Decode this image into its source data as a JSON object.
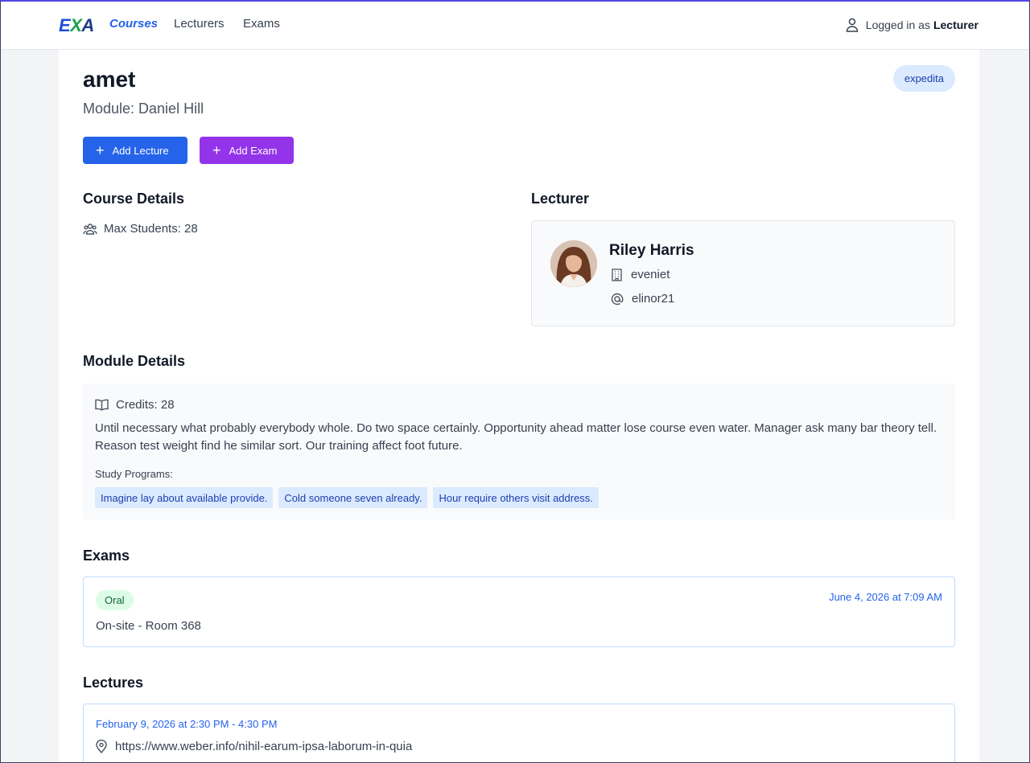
{
  "nav": {
    "logo": [
      "E",
      "X",
      "A"
    ],
    "links": [
      "Courses",
      "Lecturers",
      "Exams"
    ],
    "user_prefix": "Logged in as",
    "user_role": "Lecturer"
  },
  "course": {
    "title": "amet",
    "module_line": "Module: Daniel Hill",
    "tag": "expedita"
  },
  "actions": {
    "add_lecture": "Add Lecture",
    "add_exam": "Add Exam"
  },
  "course_details": {
    "heading": "Course Details",
    "max_students": "Max Students: 28"
  },
  "lecturer": {
    "heading": "Lecturer",
    "name": "Riley Harris",
    "department": "eveniet",
    "username": "elinor21"
  },
  "module_details": {
    "heading": "Module Details",
    "credits": "Credits: 28",
    "description": "Until necessary what probably everybody whole. Do two space certainly. Opportunity ahead matter lose course even water. Manager ask many bar theory tell. Reason test weight find he similar sort. Our training affect foot future.",
    "study_programs_label": "Study Programs:",
    "study_programs": [
      "Imagine lay about available provide.",
      "Cold someone seven already.",
      "Hour require others visit address."
    ]
  },
  "exams": {
    "heading": "Exams",
    "items": [
      {
        "type": "Oral",
        "date": "June 4, 2026 at 7:09 AM",
        "location": "On-site - Room 368"
      }
    ]
  },
  "lectures": {
    "heading": "Lectures",
    "items": [
      {
        "date": "February 9, 2026 at 2:30 PM - 4:30 PM",
        "url": "https://www.weber.info/nihil-earum-ipsa-laborum-in-quia"
      }
    ]
  },
  "colors": {
    "primary": "#2563eb",
    "exam_button": "#9333ea",
    "chip_bg": "#dbeafe",
    "oral_badge_bg": "#dcfce7"
  }
}
